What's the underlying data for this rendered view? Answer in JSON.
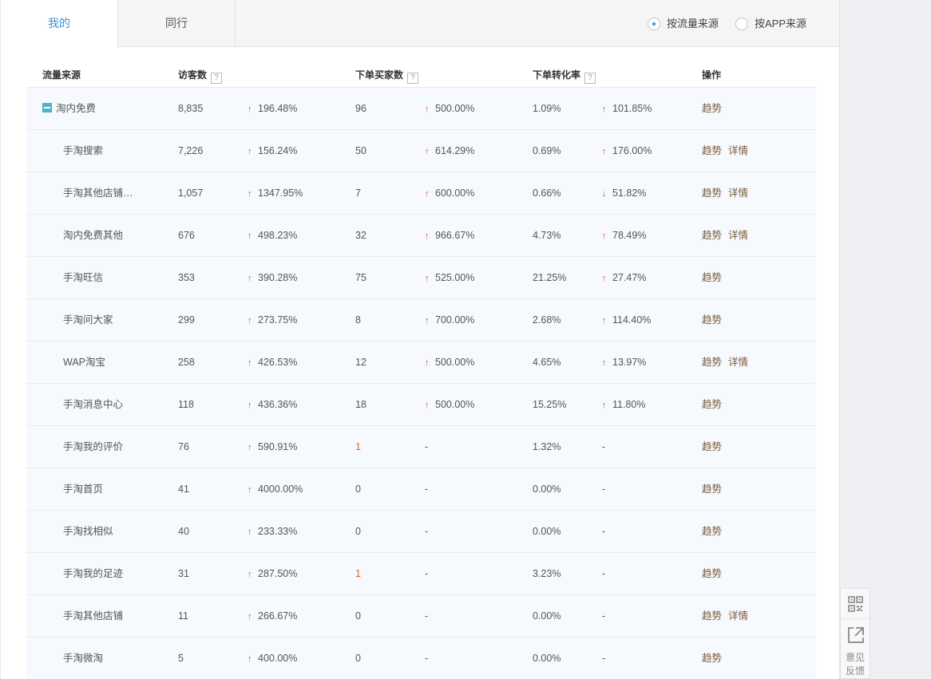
{
  "tabs": [
    {
      "label": "我的",
      "active": true
    },
    {
      "label": "同行",
      "active": false
    }
  ],
  "source_toggle": {
    "options": [
      "按流量来源",
      "按APP来源"
    ],
    "selected": "按流量来源"
  },
  "table": {
    "headers": {
      "source": "流量来源",
      "visitors": "访客数",
      "buyers": "下单买家数",
      "conversion": "下单转化率",
      "actions": "操作"
    },
    "help_glyph": "?",
    "action_labels": {
      "trend": "趋势",
      "detail": "详情"
    },
    "rows": [
      {
        "name": "淘内免费",
        "parent": true,
        "visitors": "8,835",
        "visitors_change": "196.48%",
        "visitors_dir": "up",
        "buyers": "96",
        "buyers_change": "500.00%",
        "buyers_dir": "up",
        "conversion": "1.09%",
        "conversion_change": "101.85%",
        "conversion_dir": "up",
        "detail": false
      },
      {
        "name": "手淘搜索",
        "visitors": "7,226",
        "visitors_change": "156.24%",
        "visitors_dir": "up",
        "buyers": "50",
        "buyers_change": "614.29%",
        "buyers_dir": "up",
        "conversion": "0.69%",
        "conversion_change": "176.00%",
        "conversion_dir": "up",
        "detail": true
      },
      {
        "name": "手淘其他店铺…",
        "visitors": "1,057",
        "visitors_change": "1347.95%",
        "visitors_dir": "up",
        "buyers": "7",
        "buyers_change": "600.00%",
        "buyers_dir": "up",
        "conversion": "0.66%",
        "conversion_change": "51.82%",
        "conversion_dir": "down",
        "detail": true
      },
      {
        "name": "淘内免费其他",
        "visitors": "676",
        "visitors_change": "498.23%",
        "visitors_dir": "up",
        "buyers": "32",
        "buyers_change": "966.67%",
        "buyers_dir": "up",
        "conversion": "4.73%",
        "conversion_change": "78.49%",
        "conversion_dir": "up",
        "detail": true
      },
      {
        "name": "手淘旺信",
        "visitors": "353",
        "visitors_change": "390.28%",
        "visitors_dir": "up",
        "buyers": "75",
        "buyers_change": "525.00%",
        "buyers_dir": "up",
        "conversion": "21.25%",
        "conversion_change": "27.47%",
        "conversion_dir": "up",
        "detail": false
      },
      {
        "name": "手淘问大家",
        "visitors": "299",
        "visitors_change": "273.75%",
        "visitors_dir": "up",
        "buyers": "8",
        "buyers_change": "700.00%",
        "buyers_dir": "up",
        "conversion": "2.68%",
        "conversion_change": "114.40%",
        "conversion_dir": "up",
        "detail": false
      },
      {
        "name": "WAP淘宝",
        "visitors": "258",
        "visitors_change": "426.53%",
        "visitors_dir": "up",
        "buyers": "12",
        "buyers_change": "500.00%",
        "buyers_dir": "up",
        "conversion": "4.65%",
        "conversion_change": "13.97%",
        "conversion_dir": "up",
        "detail": true
      },
      {
        "name": "手淘消息中心",
        "visitors": "118",
        "visitors_change": "436.36%",
        "visitors_dir": "up",
        "buyers": "18",
        "buyers_change": "500.00%",
        "buyers_dir": "up",
        "conversion": "15.25%",
        "conversion_change": "11.80%",
        "conversion_dir": "up",
        "detail": false
      },
      {
        "name": "手淘我的评价",
        "visitors": "76",
        "visitors_change": "590.91%",
        "visitors_dir": "up",
        "buyers": "1",
        "buyers_highlight": true,
        "buyers_change": "-",
        "buyers_dir": "none",
        "conversion": "1.32%",
        "conversion_change": "-",
        "conversion_dir": "none",
        "detail": false
      },
      {
        "name": "手淘首页",
        "visitors": "41",
        "visitors_change": "4000.00%",
        "visitors_dir": "up",
        "buyers": "0",
        "buyers_change": "-",
        "buyers_dir": "none",
        "conversion": "0.00%",
        "conversion_change": "-",
        "conversion_dir": "none",
        "detail": false
      },
      {
        "name": "手淘找相似",
        "visitors": "40",
        "visitors_change": "233.33%",
        "visitors_dir": "up",
        "buyers": "0",
        "buyers_change": "-",
        "buyers_dir": "none",
        "conversion": "0.00%",
        "conversion_change": "-",
        "conversion_dir": "none",
        "detail": false
      },
      {
        "name": "手淘我的足迹",
        "visitors": "31",
        "visitors_change": "287.50%",
        "visitors_dir": "up",
        "buyers": "1",
        "buyers_highlight": true,
        "buyers_change": "-",
        "buyers_dir": "none",
        "conversion": "3.23%",
        "conversion_change": "-",
        "conversion_dir": "none",
        "detail": false
      },
      {
        "name": "手淘其他店铺",
        "visitors": "11",
        "visitors_change": "266.67%",
        "visitors_dir": "up",
        "buyers": "0",
        "buyers_change": "-",
        "buyers_dir": "none",
        "conversion": "0.00%",
        "conversion_change": "-",
        "conversion_dir": "none",
        "detail": true
      },
      {
        "name": "手淘微淘",
        "visitors": "5",
        "visitors_change": "400.00%",
        "visitors_dir": "up",
        "buyers": "0",
        "buyers_change": "-",
        "buyers_dir": "none",
        "conversion": "0.00%",
        "conversion_change": "-",
        "conversion_dir": "none",
        "detail": false
      }
    ]
  },
  "side_tools": {
    "qr": "qr-code-icon",
    "share": "external-link-icon",
    "feedback_line1": "意见",
    "feedback_line2": "反馈"
  },
  "colors": {
    "accent": "#3c8dd8",
    "up": "#e0533f",
    "down": "#3a9b2b",
    "row_bg": "#f6f9fd"
  }
}
